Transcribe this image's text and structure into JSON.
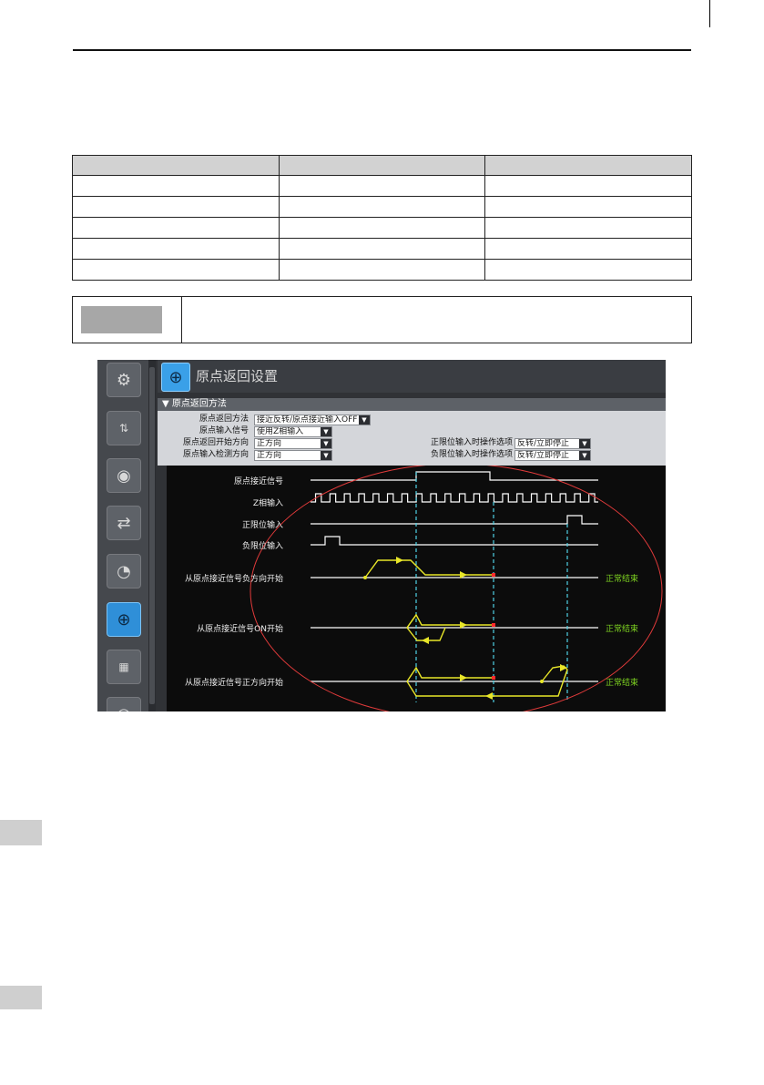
{
  "screenshot": {
    "title": "原点返回设置",
    "section": "▼ 原点返回方法",
    "toolbar_icons": [
      "gear-search-icon",
      "io-pulse-icon",
      "disk-icon",
      "swap-arrows-icon",
      "speedometer-icon",
      "origin-crosshair-icon",
      "numeric-123-icon",
      "extra-icon"
    ],
    "fields": [
      {
        "label": "原点返回方法",
        "value": "接近反转/原点接近输入OFF"
      },
      {
        "label": "原点输入信号",
        "value": "使用Z相输入"
      },
      {
        "label": "原点返回开始方向",
        "value": "正方向"
      },
      {
        "label": "原点输入检测方向",
        "value": "正方向"
      },
      {
        "label": "正限位输入时操作选项",
        "value": "反转/立即停止"
      },
      {
        "label": "负限位输入时操作选项",
        "value": "反转/立即停止"
      }
    ],
    "signals": [
      "原点接近信号",
      "Z相输入",
      "正限位输入",
      "负限位输入"
    ],
    "moves": [
      "从原点接近信号负方向开始",
      "从原点接近信号ON开始",
      "从原点接近信号正方向开始"
    ],
    "end_label": "正常结束",
    "colors": {
      "trace": "#ffffff",
      "move": "#e8e628",
      "dashed": "#4fd2e6",
      "stop": "#ff2a2a",
      "ellipse": "#e03a3a",
      "end": "#7ed321"
    }
  }
}
